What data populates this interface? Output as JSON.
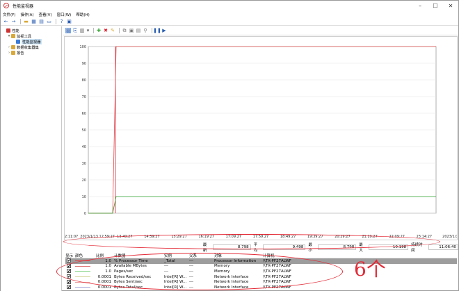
{
  "app": {
    "title": "性能监视器"
  },
  "menu": [
    "文件(F)",
    "操作(A)",
    "查看(V)",
    "窗口(W)",
    "帮助(H)"
  ],
  "tree": [
    {
      "label": "性能",
      "level": 0,
      "arrow": "",
      "color": "#c33"
    },
    {
      "label": "监视工具",
      "level": 1,
      "arrow": "▾",
      "color": "#d8a93a"
    },
    {
      "label": "性能监视器",
      "level": 2,
      "arrow": "",
      "color": "#3a7bd5",
      "selected": true
    },
    {
      "label": "数据收集器集",
      "level": 1,
      "arrow": "›",
      "color": "#d8a93a"
    },
    {
      "label": "报告",
      "level": 1,
      "arrow": "›",
      "color": "#d8a93a"
    }
  ],
  "chart_data": {
    "type": "line",
    "yticks": [
      "0",
      "10",
      "20",
      "30",
      "40",
      "50",
      "60",
      "70",
      "80",
      "90",
      "100"
    ],
    "ylim": [
      0,
      100
    ],
    "xticks": [
      "12:11:07",
      "2023/1/13 12:59:27",
      "13:49:27",
      "14:39:27",
      "15:29:27",
      "16:19:27",
      "17:09:27",
      "17:59:27",
      "18:49:27",
      "19:39:27",
      "20:29:27",
      "21:19:27",
      "22:09:27",
      "23:14:27",
      "2023/1/13"
    ],
    "series": [
      {
        "color": "#e04848",
        "x": [
          0,
          0.07,
          0.08,
          1
        ],
        "values": [
          0,
          0,
          100,
          100
        ]
      },
      {
        "color": "#2ea32e",
        "x": [
          0,
          0.07,
          0.08,
          1
        ],
        "values": [
          0,
          0,
          10,
          10
        ]
      }
    ]
  },
  "stats": {
    "last_label": "最新",
    "last_value": "8.798",
    "avg_label": "平均",
    "avg_value": "9.498",
    "min_label": "最小",
    "min_value": "8.798",
    "max_label": "最大",
    "max_value": "10.198",
    "dur_label": "持续时间",
    "dur_value": "11:06:40"
  },
  "legend": {
    "headers": [
      "显示",
      "颜色",
      "比例",
      "计数器",
      "实例",
      "父系",
      "对象",
      "计算机"
    ],
    "rows": [
      {
        "checked": "✔",
        "color": "#e04848",
        "scale": "1.0",
        "counter": "% Processor Time",
        "instance": "_Total",
        "parent": "---",
        "object": "Processor Information",
        "computer": "\\\\TX-PF27ALWF",
        "selected": true
      },
      {
        "checked": "✔",
        "color": "#e07070",
        "scale": "1.0",
        "counter": "Available MBytes",
        "instance": "---",
        "parent": "---",
        "object": "Memory",
        "computer": "\\\\TX-PF27ALWF"
      },
      {
        "checked": "✔",
        "color": "#7fd17f",
        "scale": "1.0",
        "counter": "Pages/sec",
        "instance": "---",
        "parent": "---",
        "object": "Memory",
        "computer": "\\\\TX-PF27ALWF"
      },
      {
        "checked": "✔",
        "color": "#d7d7a0",
        "scale": "0.0001",
        "counter": "Bytes Received/sec",
        "instance": "Intel[R] W...",
        "parent": "---",
        "object": "Network Interface",
        "computer": "\\\\TX-PF27ALWF"
      },
      {
        "checked": "✔",
        "color": "#e89a9a",
        "scale": "0.0001",
        "counter": "Bytes Sent/sec",
        "instance": "Intel[R] W...",
        "parent": "---",
        "object": "Network Interface",
        "computer": "\\\\TX-PF27ALWF"
      },
      {
        "checked": "✔",
        "color": "#a0a0d8",
        "scale": "0.0001",
        "counter": "Bytes Total/sec",
        "instance": "Intel[R] W...",
        "parent": "---",
        "object": "Network Interface",
        "computer": "\\\\TX-PF27ALWF"
      }
    ]
  },
  "annotation": {
    "text": "6个",
    "color": "#e32a36"
  }
}
